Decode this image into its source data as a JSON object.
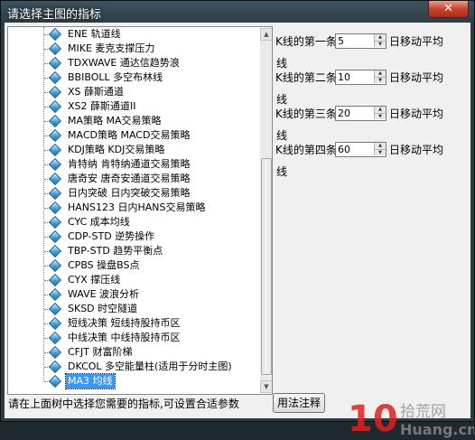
{
  "window": {
    "title": "请选择主图的指标",
    "close_glyph": "✕"
  },
  "tree": {
    "items": [
      {
        "label": "ENE 轨道线"
      },
      {
        "label": "MIKE 麦克支撑压力"
      },
      {
        "label": "TDXWAVE 通达信趋势浪"
      },
      {
        "label": "BBIBOLL 多空布林线"
      },
      {
        "label": "XS 薛斯通道"
      },
      {
        "label": "XS2 薛斯通道II"
      },
      {
        "label": "MA策略 MA交易策略"
      },
      {
        "label": "MACD策略 MACD交易策略"
      },
      {
        "label": "KDJ策略 KDJ交易策略"
      },
      {
        "label": "肯特纳 肯特纳通道交易策略"
      },
      {
        "label": "唐奇安 唐奇安通道交易策略"
      },
      {
        "label": "日内突破 日内突破交易策略"
      },
      {
        "label": "HANS123 日内HANS交易策略"
      },
      {
        "label": "CYC 成本均线"
      },
      {
        "label": "CDP-STD 逆势操作"
      },
      {
        "label": "TBP-STD 趋势平衡点"
      },
      {
        "label": "CPBS 操盘BS点"
      },
      {
        "label": "CYX 撑压线"
      },
      {
        "label": "WAVE 波浪分析"
      },
      {
        "label": "SKSD 时空隧道"
      },
      {
        "label": "短线决策 短线持股持币区"
      },
      {
        "label": "中线决策 中线持股持币区"
      },
      {
        "label": "CFJT 财富阶梯"
      },
      {
        "label": "DKCOL 多空能量柱(适用于分时主图)"
      },
      {
        "label": "MA3 均线",
        "selected": true
      }
    ]
  },
  "params": [
    {
      "label": "K线的第一条",
      "value": "5",
      "suffix": "日移动平均",
      "suffix2": "线"
    },
    {
      "label": "K线的第二条",
      "value": "10",
      "suffix": "日移动平均",
      "suffix2": "线"
    },
    {
      "label": "K线的第三条",
      "value": "20",
      "suffix": "日移动平均",
      "suffix2": "线"
    },
    {
      "label": "K线的第四条",
      "value": "60",
      "suffix": "日移动平均",
      "suffix2": "线"
    }
  ],
  "status_text": "请在上面树中选择您需要的指标,可设置合适参数",
  "help_button": "用法注释",
  "watermark": {
    "digits": "10",
    "brand": "拾荒网",
    "url": "Huang.cn"
  },
  "colors": {
    "selection": "#3399ff",
    "close": "#c7432c"
  }
}
